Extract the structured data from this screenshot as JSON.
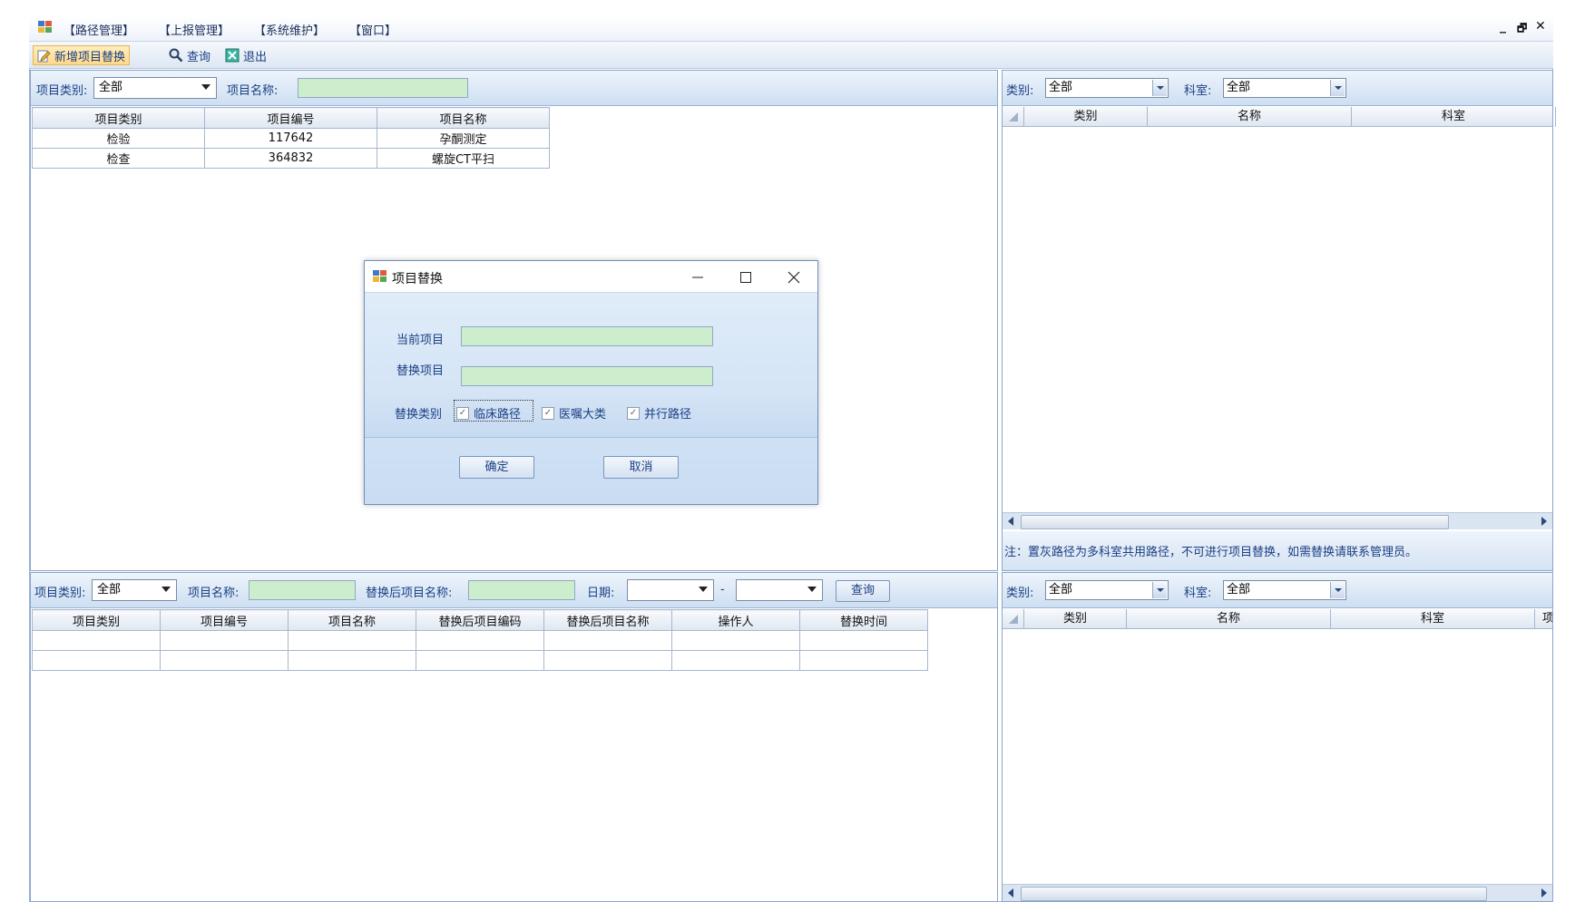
{
  "menubar": {
    "items": [
      "【路径管理】",
      "【上报管理】",
      "【系统维护】",
      "【窗口】"
    ],
    "controls": [
      "_",
      "🗗",
      "✕"
    ]
  },
  "toolbar": {
    "add_label": "新增项目替换",
    "query_label": "查询",
    "exit_label": "退出"
  },
  "top_left": {
    "filter": {
      "category_label": "项目类别:",
      "category_value": "全部",
      "name_label": "项目名称:",
      "name_value": ""
    },
    "table": {
      "columns": [
        "项目类别",
        "项目编号",
        "项目名称"
      ],
      "rows": [
        [
          "检验",
          "117642",
          "孕酮测定"
        ],
        [
          "检查",
          "364832",
          "螺旋CT平扫"
        ]
      ]
    }
  },
  "top_right": {
    "filter": {
      "category_label": "类别:",
      "category_value": "全部",
      "dept_label": "科室:",
      "dept_value": "全部"
    },
    "columns": [
      "类别",
      "名称",
      "科室"
    ],
    "note": "注：置灰路径为多科室共用路径，不可进行项目替换，如需替换请联系管理员。"
  },
  "bottom_left": {
    "filter": {
      "category_label": "项目类别:",
      "category_value": "全部",
      "name_label": "项目名称:",
      "replaced_name_label": "替换后项目名称:",
      "date_label": "日期:",
      "date_sep": "-",
      "query_button": "查询"
    },
    "table": {
      "columns": [
        "项目类别",
        "项目编号",
        "项目名称",
        "替换后项目编码",
        "替换后项目名称",
        "操作人",
        "替换时间"
      ]
    }
  },
  "bottom_right": {
    "filter": {
      "category_label": "类别:",
      "category_value": "全部",
      "dept_label": "科室:",
      "dept_value": "全部"
    },
    "columns": [
      "类别",
      "名称",
      "科室",
      "项目"
    ]
  },
  "dialog": {
    "title": "项目替换",
    "current_label": "当前项目",
    "replace_label": "替换项目",
    "type_label": "替换类别",
    "options": [
      "临床路径",
      "医嘱大类",
      "并行路径"
    ],
    "ok": "确定",
    "cancel": "取消"
  }
}
